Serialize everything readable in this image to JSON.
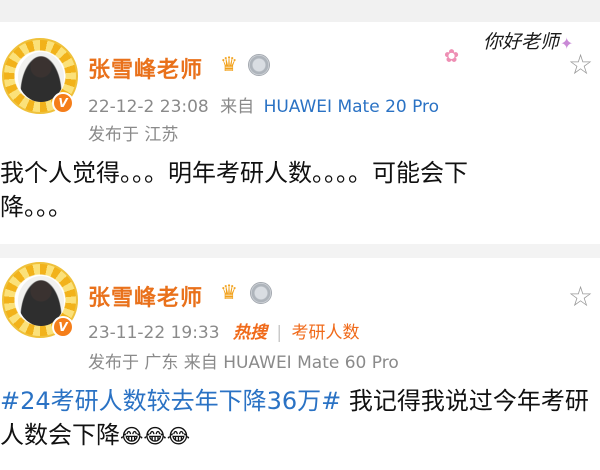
{
  "post1": {
    "username": "张雪峰老师",
    "date": "22-12-2 23:08",
    "source_prefix": "来自",
    "device": "HUAWEI Mate 20 Pro",
    "location": "发布于 江苏",
    "line1": "我个人觉得。。。明年考研人数。。。。可能会下",
    "line2": "降。。。"
  },
  "post2": {
    "username": "张雪峰老师",
    "date": "23-11-22 19:33",
    "hot_label": "热搜",
    "hot_topic": "考研人数",
    "location_source": "发布于 广东  来自 HUAWEI Mate 60 Pro",
    "hashtag": "#24考研人数较去年下降36万#",
    "line1_rest": " 我记得我说过今年考研",
    "line2": "人数会下降",
    "emoji": "😂😂😂"
  },
  "sticker": {
    "text": "你好老师"
  },
  "icons": {
    "verified": "verified-v-icon",
    "crown": "crown-icon",
    "medal": "medal-icon",
    "star": "star-icon"
  },
  "colors": {
    "username": "#e9711b",
    "hashtag": "#2a72c4",
    "meta": "#8a8a8a",
    "hot": "#f06a1a"
  }
}
